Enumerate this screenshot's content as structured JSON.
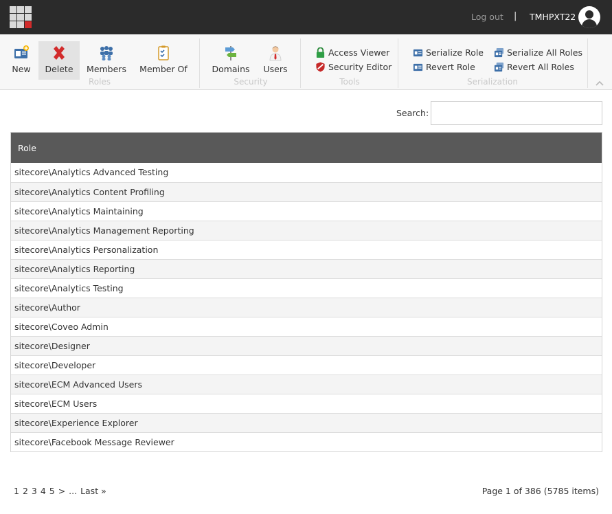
{
  "header": {
    "logout_label": "Log out",
    "separator": "|",
    "username": "TMHPXT22"
  },
  "ribbon": {
    "groups": {
      "roles": "Roles",
      "security": "Security",
      "tools": "Tools",
      "serialization": "Serialization"
    },
    "buttons": {
      "new": "New",
      "delete": "Delete",
      "members": "Members",
      "member_of": "Member Of",
      "domains": "Domains",
      "users": "Users",
      "access_viewer": "Access Viewer",
      "security_editor": "Security Editor",
      "serialize_role": "Serialize Role",
      "revert_role": "Revert Role",
      "serialize_all_roles": "Serialize All Roles",
      "revert_all_roles": "Revert All Roles"
    },
    "active_button": "delete"
  },
  "search": {
    "label": "Search:",
    "value": "",
    "placeholder": ""
  },
  "table": {
    "column_header": "Role",
    "rows": [
      "sitecore\\Analytics Advanced Testing",
      "sitecore\\Analytics Content Profiling",
      "sitecore\\Analytics Maintaining",
      "sitecore\\Analytics Management Reporting",
      "sitecore\\Analytics Personalization",
      "sitecore\\Analytics Reporting",
      "sitecore\\Analytics Testing",
      "sitecore\\Author",
      "sitecore\\Coveo Admin",
      "sitecore\\Designer",
      "sitecore\\Developer",
      "sitecore\\ECM Advanced Users",
      "sitecore\\ECM Users",
      "sitecore\\Experience Explorer",
      "sitecore\\Facebook Message Reviewer"
    ]
  },
  "pager": {
    "pages": [
      "1",
      "2",
      "3",
      "4",
      "5"
    ],
    "next": ">",
    "ellipsis": "...",
    "last": "Last »",
    "info": "Page 1 of 386 (5785 items)"
  },
  "colors": {
    "topbar": "#2b2b2b",
    "table_header": "#595959",
    "delete_red": "#d22b2b",
    "icon_blue": "#3d6fa8"
  }
}
